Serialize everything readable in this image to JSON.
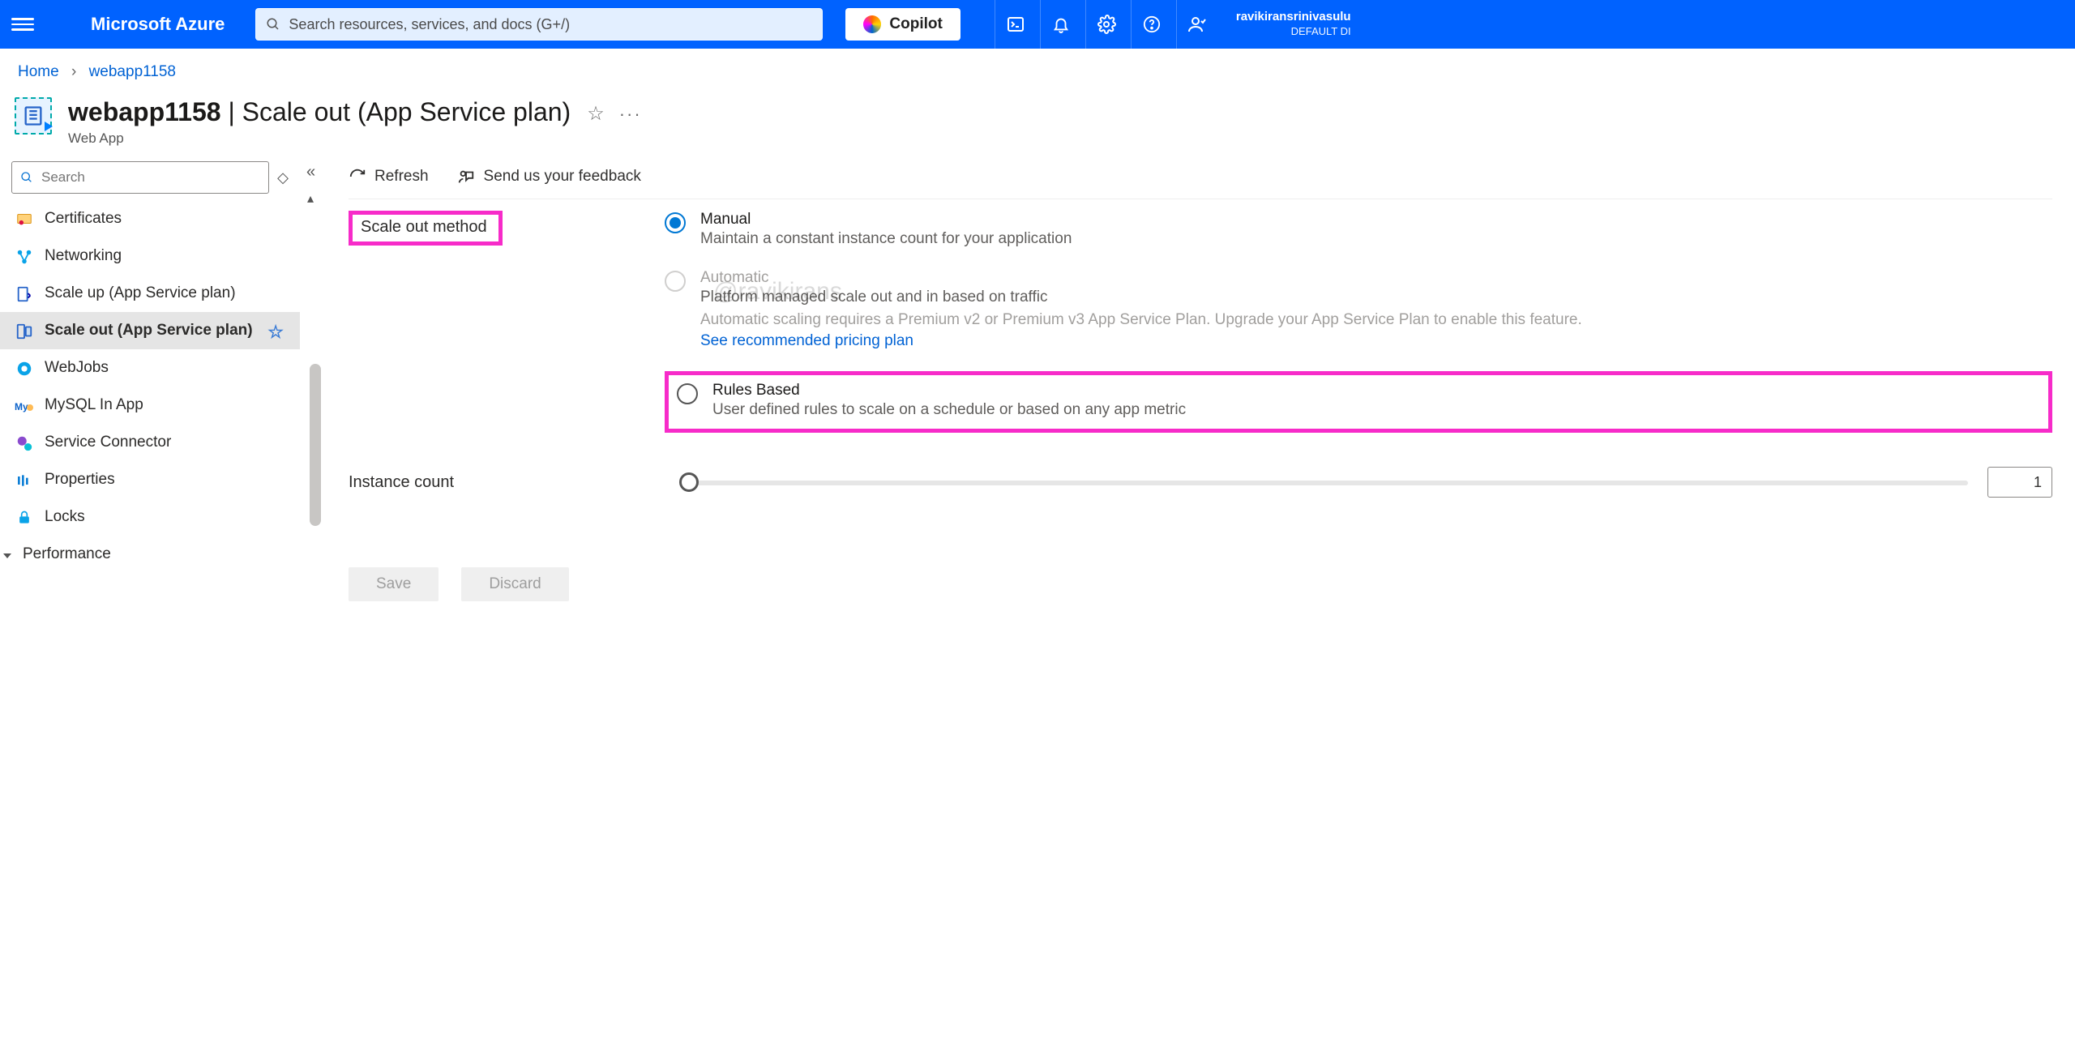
{
  "header": {
    "brand": "Microsoft Azure",
    "search_placeholder": "Search resources, services, and docs (G+/)",
    "copilot": "Copilot",
    "user_name": "ravikiransrinivasulu",
    "user_tenant": "DEFAULT DI"
  },
  "breadcrumb": {
    "home": "Home",
    "current": "webapp1158"
  },
  "page": {
    "resource_name": "webapp1158",
    "page_title": "Scale out (App Service plan)",
    "resource_type": "Web App"
  },
  "sidebar": {
    "search_placeholder": "Search",
    "items": [
      {
        "label": "Certificates"
      },
      {
        "label": "Networking"
      },
      {
        "label": "Scale up (App Service plan)"
      },
      {
        "label": "Scale out (App Service plan)",
        "selected": true,
        "fav": true
      },
      {
        "label": "WebJobs"
      },
      {
        "label": "MySQL In App"
      },
      {
        "label": "Service Connector"
      },
      {
        "label": "Properties"
      },
      {
        "label": "Locks"
      }
    ],
    "group": "Performance"
  },
  "toolbar": {
    "refresh": "Refresh",
    "feedback": "Send us your feedback"
  },
  "scale": {
    "method_label": "Scale out method",
    "instance_label": "Instance count",
    "instance_value": "1",
    "options": {
      "manual": {
        "title": "Manual",
        "desc": "Maintain a constant instance count for your application"
      },
      "automatic": {
        "title": "Automatic",
        "desc": "Platform managed scale out and in based on traffic",
        "hint": "Automatic scaling requires a Premium v2 or Premium v3 App Service Plan. Upgrade your App Service Plan to enable this feature.",
        "link": "See recommended pricing plan"
      },
      "rules": {
        "title": "Rules Based",
        "desc": "User defined rules to scale on a schedule or based on any app metric"
      }
    }
  },
  "footer": {
    "save": "Save",
    "discard": "Discard"
  },
  "watermark": "@ravikirans"
}
